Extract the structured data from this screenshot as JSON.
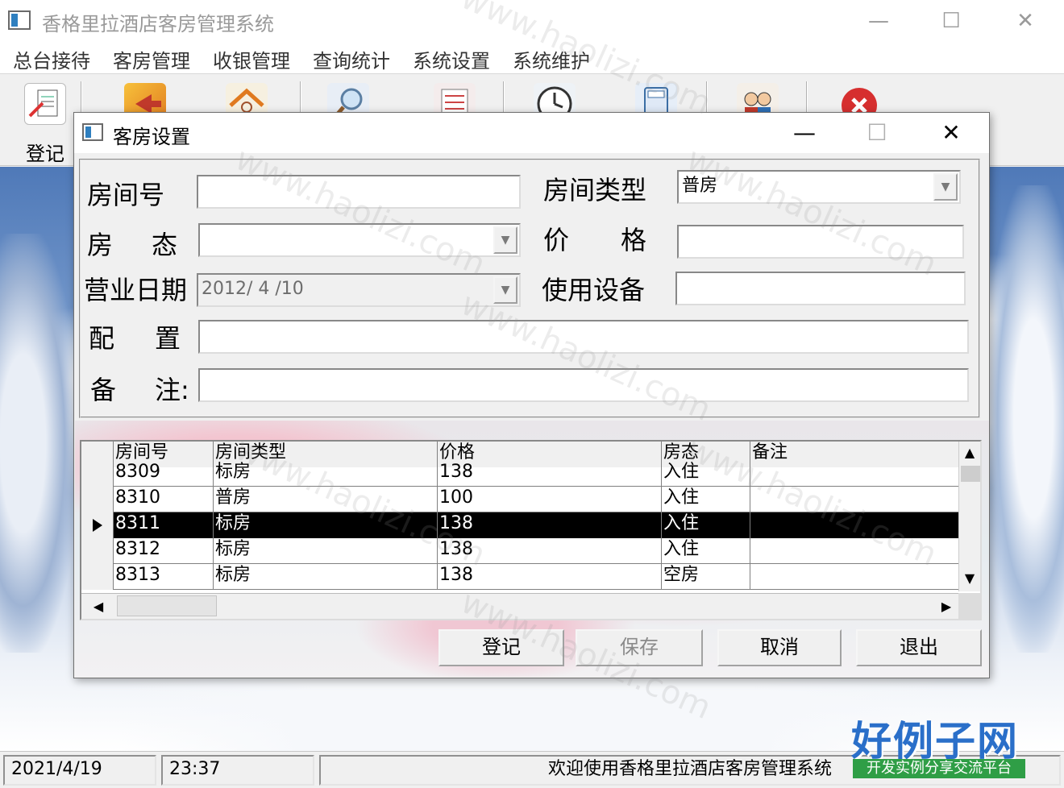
{
  "window": {
    "title": "香格里拉酒店客房管理系统",
    "controls": {
      "minimize": "—",
      "maximize": "☐",
      "close": "✕"
    }
  },
  "menu": [
    "总台接待",
    "客房管理",
    "收银管理",
    "查询统计",
    "系统设置",
    "系统维护"
  ],
  "toolbar": [
    {
      "label": "登记",
      "icon": "register-icon"
    },
    {
      "label": "",
      "icon": "checkout-icon"
    },
    {
      "label": "",
      "icon": "room-icon"
    },
    {
      "label": "",
      "icon": "search-icon"
    },
    {
      "label": "",
      "icon": "report-icon"
    },
    {
      "label": "",
      "icon": "clock-icon"
    },
    {
      "label": "",
      "icon": "calculator-icon"
    },
    {
      "label": "",
      "icon": "users-icon"
    },
    {
      "label": "",
      "icon": "exit-icon"
    }
  ],
  "dialog": {
    "title": "客房设置",
    "controls": {
      "minimize": "—",
      "maximize": "☐",
      "close": "✕"
    },
    "form": {
      "room_no_label": "房间号",
      "room_no_value": "",
      "room_type_label": "房间类型",
      "room_type_value": "普房",
      "room_status_label_1": "房",
      "room_status_label_2": "态",
      "room_status_value": "",
      "price_label_1": "价",
      "price_label_2": "格",
      "price_value": "",
      "business_date_label": "营业日期",
      "business_date_value": "2012/ 4 /10",
      "equipment_label": "使用设备",
      "equipment_value": "",
      "config_label_1": "配",
      "config_label_2": "置",
      "config_value": "",
      "remark_label_1": "备",
      "remark_label_2": "注:",
      "remark_value": ""
    },
    "grid": {
      "columns": [
        "房间号",
        "房间类型",
        "价格",
        "房态",
        "备注"
      ],
      "rows": [
        {
          "room_no": "8309",
          "type": "标房",
          "price": "138",
          "status": "入住",
          "remark": ""
        },
        {
          "room_no": "8310",
          "type": "普房",
          "price": "100",
          "status": "入住",
          "remark": ""
        },
        {
          "room_no": "8311",
          "type": "标房",
          "price": "138",
          "status": "入住",
          "remark": "",
          "selected": true
        },
        {
          "room_no": "8312",
          "type": "标房",
          "price": "138",
          "status": "入住",
          "remark": ""
        },
        {
          "room_no": "8313",
          "type": "标房",
          "price": "138",
          "status": "空房",
          "remark": ""
        }
      ]
    },
    "buttons": {
      "register": "登记",
      "save": "保存",
      "cancel": "取消",
      "exit": "退出"
    }
  },
  "status": {
    "date": "2021/4/19",
    "time": "23:37",
    "message": "欢迎使用香格里拉酒店客房管理系统"
  },
  "brand": {
    "big": "好例子网",
    "small": "开发实例分享交流平台"
  },
  "watermark_text": "www.haolizi.com",
  "colors": {
    "selection": "#000000",
    "brand_blue": "#2a6fc9",
    "brand_green": "#2f9e46"
  }
}
